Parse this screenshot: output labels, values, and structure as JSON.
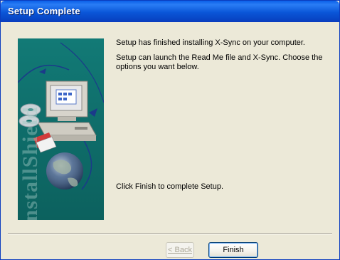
{
  "window": {
    "title": "Setup Complete"
  },
  "banner": {
    "vertical_text": "InstallShield"
  },
  "content": {
    "message_finished": "Setup has finished installing X-Sync on your computer.",
    "message_launch": "Setup can launch the Read Me file and X-Sync.  Choose the options you want below.",
    "message_click_finish": "Click Finish to complete Setup."
  },
  "buttons": {
    "back_label": "< Back",
    "finish_label": "Finish"
  },
  "colors": {
    "titlebar": "#0a56d8",
    "banner": "#0f6e6b",
    "dialog_background": "#ece9d8"
  }
}
